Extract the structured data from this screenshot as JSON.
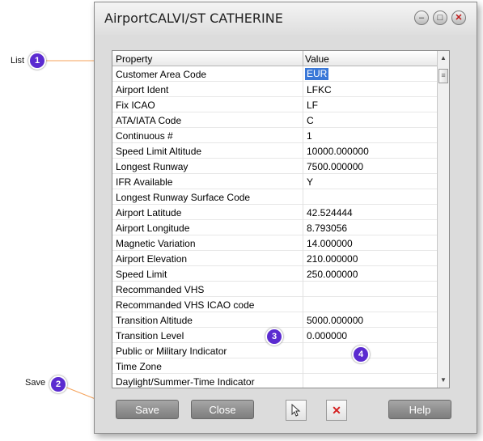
{
  "window": {
    "title": "AirportCALVI/ST CATHERINE"
  },
  "grid": {
    "headers": {
      "property": "Property",
      "value": "Value"
    },
    "rows": [
      {
        "property": "Customer Area Code",
        "value": "EUR",
        "selected": true
      },
      {
        "property": "Airport Ident",
        "value": "LFKC"
      },
      {
        "property": "Fix ICAO",
        "value": "LF"
      },
      {
        "property": "ATA/IATA Code",
        "value": "C"
      },
      {
        "property": "Continuous #",
        "value": "1"
      },
      {
        "property": "Speed Limit Altitude",
        "value": "10000.000000"
      },
      {
        "property": "Longest Runway",
        "value": "7500.000000"
      },
      {
        "property": "IFR Available",
        "value": "Y"
      },
      {
        "property": "Longest Runway Surface Code",
        "value": ""
      },
      {
        "property": "Airport Latitude",
        "value": "42.524444"
      },
      {
        "property": "Airport Longitude",
        "value": "8.793056"
      },
      {
        "property": "Magnetic Variation",
        "value": "14.000000"
      },
      {
        "property": "Airport Elevation",
        "value": "210.000000"
      },
      {
        "property": "Speed Limit",
        "value": "250.000000"
      },
      {
        "property": "Recommanded VHS",
        "value": ""
      },
      {
        "property": "Recommanded VHS ICAO code",
        "value": ""
      },
      {
        "property": "Transition Altitude",
        "value": "5000.000000"
      },
      {
        "property": "Transition Level",
        "value": "0.000000"
      },
      {
        "property": "Public or Military Indicator",
        "value": ""
      },
      {
        "property": "Time Zone",
        "value": ""
      },
      {
        "property": "Daylight/Summer-Time Indicator",
        "value": ""
      }
    ]
  },
  "buttons": {
    "save": "Save",
    "close": "Close",
    "help": "Help"
  },
  "callouts": [
    {
      "num": "1",
      "label": "List"
    },
    {
      "num": "2",
      "label": "Save"
    },
    {
      "num": "3",
      "label": ""
    },
    {
      "num": "4",
      "label": ""
    }
  ],
  "colors": {
    "callout": "#5b2bd0",
    "callout_line": "#f5a25a",
    "selection": "#3a78d8"
  }
}
